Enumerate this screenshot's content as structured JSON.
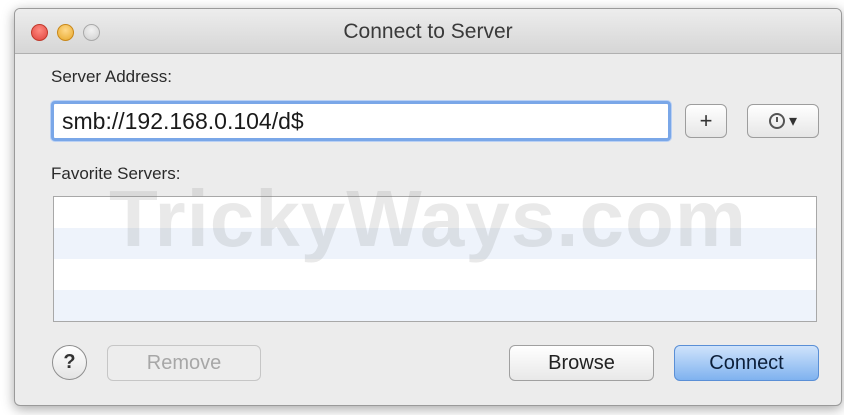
{
  "window": {
    "title": "Connect to Server"
  },
  "server_address": {
    "label": "Server Address:",
    "value": "smb://192.168.0.104/d$"
  },
  "toolbar": {
    "add_label": "+",
    "history_caret": "▾"
  },
  "favorites": {
    "label": "Favorite Servers:",
    "items": []
  },
  "watermark": "TrickyWays.com",
  "buttons": {
    "help": "?",
    "remove": "Remove",
    "browse": "Browse",
    "connect": "Connect"
  },
  "colors": {
    "focus_ring": "#7aa7e8",
    "default_button": "#7fb2ef",
    "close": "#e0443e",
    "minimize": "#e7a82a"
  },
  "icons": {
    "history": "clock-icon",
    "help": "question-icon"
  }
}
